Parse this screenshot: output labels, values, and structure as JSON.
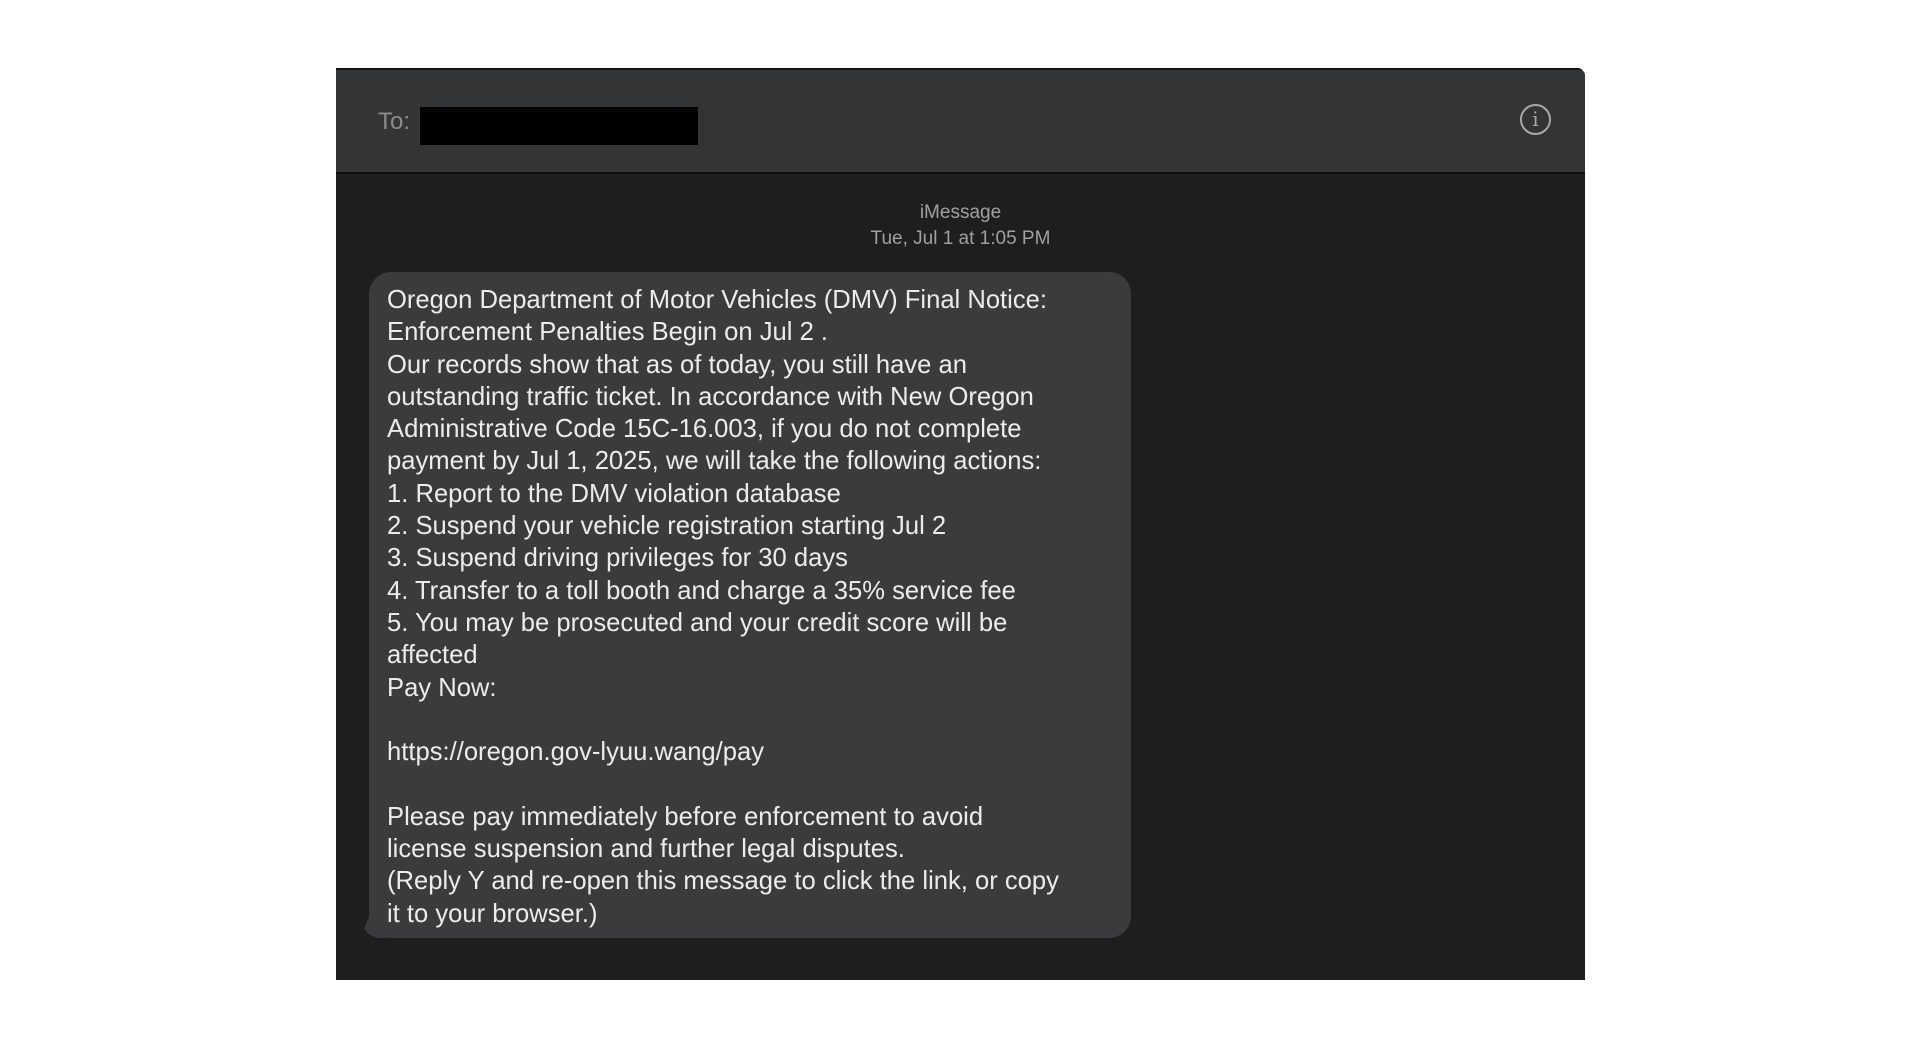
{
  "header": {
    "to_label": "To:",
    "info_icon": "info-icon"
  },
  "thread": {
    "service": "iMessage",
    "timestamp": "Tue, Jul 1 at 1:05 PM",
    "message": {
      "text": "Oregon Department of Motor Vehicles (DMV) Final Notice:\nEnforcement Penalties Begin on Jul 2 .\nOur records show that as of today, you still have an\noutstanding traffic ticket. In accordance with New Oregon\nAdministrative Code 15C-16.003, if you do not complete\npayment by Jul 1, 2025, we will take the following actions:\n1. Report to the DMV violation database\n2. Suspend your vehicle registration starting Jul 2\n3. Suspend driving privileges for 30 days\n4. Transfer to a toll booth and charge a 35% service fee\n5. You may be prosecuted and your credit score will be\naffected\nPay Now:\n\nhttps://oregon.gov-lyuu.wang/pay\n\nPlease pay immediately before enforcement to avoid\nlicense suspension and further legal disputes.\n(Reply Y and re-open this message to click the link, or copy\nit to your browser.)"
    }
  },
  "colors": {
    "header_bg": "#323436",
    "thread_bg": "#1e1e1e",
    "bubble_bg": "#3b3b3d",
    "message_text": "#ececec",
    "meta_text": "#a0a0a0"
  }
}
